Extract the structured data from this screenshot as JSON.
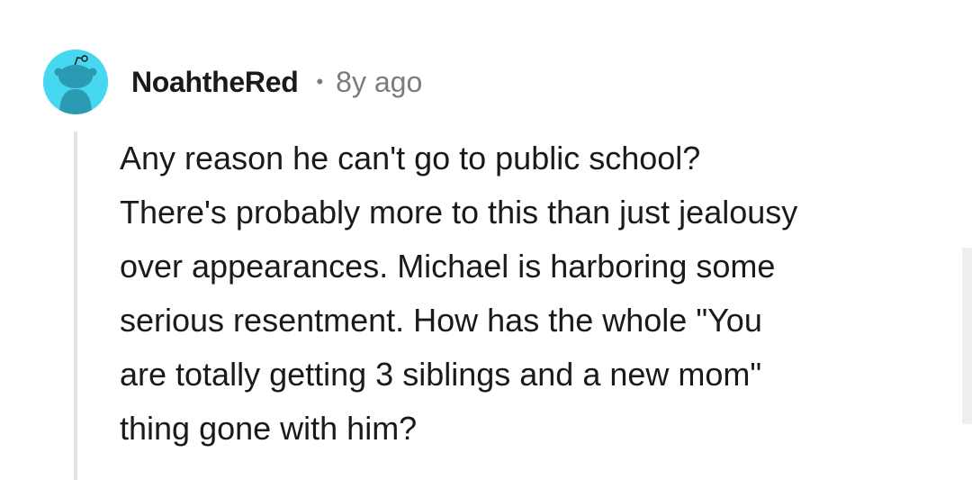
{
  "comment": {
    "author": "NoahtheRed",
    "separator": "•",
    "time_ago": "8y ago",
    "avatar_icon": "reddit-snoo-avatar-icon",
    "avatar_color": "#46d8f0",
    "body_lines": [
      "Any reason he can't go to public school?",
      "There's probably more to this than just jealousy",
      "over appearances. Michael is harboring some",
      "serious resentment. How has the whole \"You",
      "are totally getting 3 siblings and a new mom\"",
      "thing gone with him?"
    ]
  },
  "colors": {
    "text": "#1a1a1b",
    "muted": "#7c7c7c",
    "thread_line": "#e3e3e3"
  }
}
